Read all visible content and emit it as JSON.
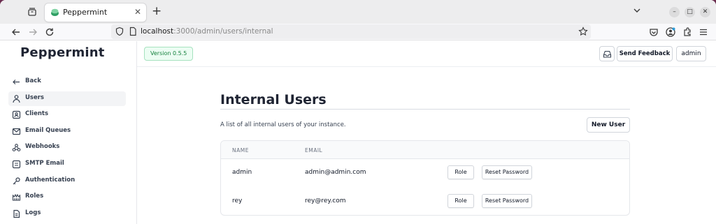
{
  "browser": {
    "tab_title": "Peppermint",
    "url_host": "localhost",
    "url_path": ":3000/admin/users/internal"
  },
  "app": {
    "brand": "Peppermint",
    "version": "Version 0.5.5",
    "header": {
      "feedback": "Send Feedback",
      "user": "admin"
    },
    "sidebar": [
      {
        "label": "Back",
        "icon": "arrow-left-icon"
      },
      {
        "label": "Users",
        "icon": "user-icon",
        "active": true
      },
      {
        "label": "Clients",
        "icon": "contact-card-icon"
      },
      {
        "label": "Email Queues",
        "icon": "mail-icon"
      },
      {
        "label": "Webhooks",
        "icon": "webhook-icon"
      },
      {
        "label": "SMTP Email",
        "icon": "smtp-icon"
      },
      {
        "label": "Authentication",
        "icon": "key-icon"
      },
      {
        "label": "Roles",
        "icon": "roles-icon"
      },
      {
        "label": "Logs",
        "icon": "document-icon"
      }
    ],
    "page": {
      "title": "Internal Users",
      "description": "A list of all internal users of your instance.",
      "new_user": "New User",
      "columns": [
        "NAME",
        "EMAIL"
      ],
      "users": [
        {
          "name": "admin",
          "email": "admin@admin.com"
        },
        {
          "name": "rey",
          "email": "rey@rey.com"
        }
      ],
      "role_label": "Role",
      "reset_label": "Reset Password"
    }
  }
}
